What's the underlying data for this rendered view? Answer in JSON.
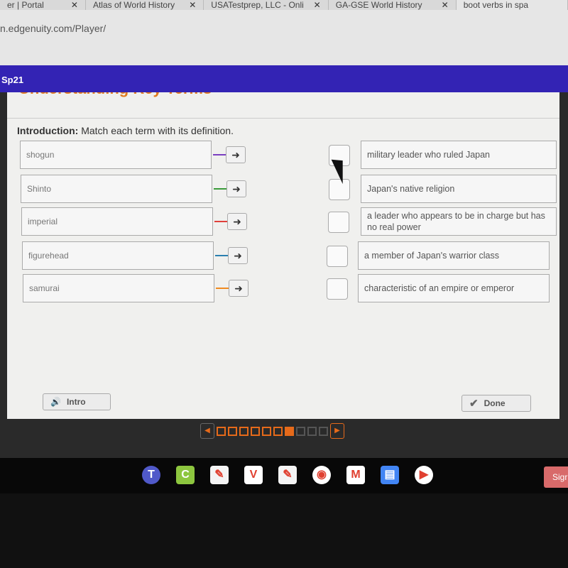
{
  "browser": {
    "tabs": [
      {
        "label": "er | Portal"
      },
      {
        "label": "Atlas of World History"
      },
      {
        "label": "USATestprep, LLC - Onli"
      },
      {
        "label": "GA-GSE World History"
      },
      {
        "label": "boot verbs in spa"
      }
    ],
    "url": "n.edgenuity.com/Player/"
  },
  "header": {
    "course": "Sp21"
  },
  "activity": {
    "title": "Understanding Key Terms",
    "intro_label": "Introduction:",
    "intro_text": " Match each term with its definition.",
    "terms": [
      {
        "label": "shogun",
        "color": "#7a3fc0"
      },
      {
        "label": "Shinto",
        "color": "#3a9a3a"
      },
      {
        "label": "imperial",
        "color": "#e0403a"
      },
      {
        "label": "figurehead",
        "color": "#2a7fb0"
      },
      {
        "label": "samurai",
        "color": "#f08a20"
      }
    ],
    "definitions": [
      "military leader who ruled Japan",
      "Japan's native religion",
      "a leader who appears to be in charge but has no real power",
      "a member of Japan's warrior class",
      "characteristic of an empire or emperor"
    ],
    "intro_button": "Intro",
    "done_button": "Done"
  },
  "pager": {
    "current": 7,
    "total": 10
  },
  "shelf": {
    "apps": [
      "teams",
      "classlink",
      "app",
      "vocab",
      "app",
      "chrome",
      "gmail",
      "docs",
      "play-store"
    ],
    "sign_label": "Sigr"
  }
}
